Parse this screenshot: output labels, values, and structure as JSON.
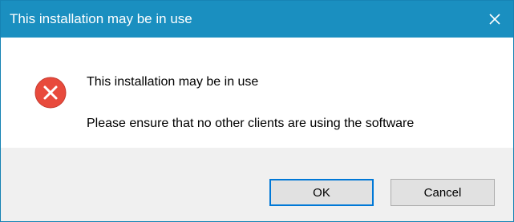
{
  "dialog": {
    "title": "This installation may be in use",
    "message": "This installation may be in use",
    "detail": "Please ensure that no other clients are using the software",
    "icon": "error-icon",
    "buttons": {
      "ok_label": "OK",
      "cancel_label": "Cancel"
    }
  },
  "colors": {
    "titlebar": "#1a8fc0",
    "error_icon": "#e84a3c",
    "footer": "#f0f0f0",
    "default_button_border": "#0078d7"
  }
}
